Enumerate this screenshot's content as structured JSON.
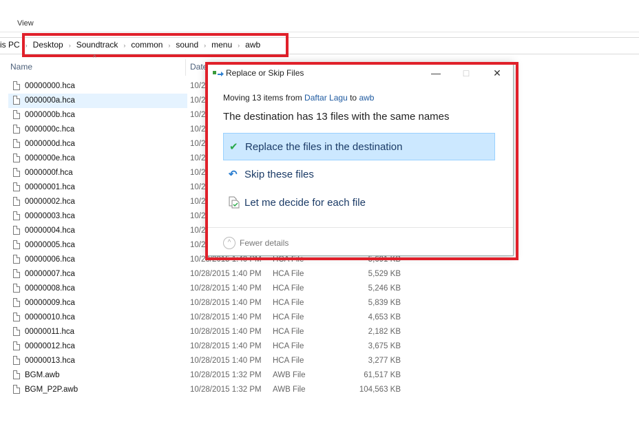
{
  "menu": {
    "view": "View"
  },
  "breadcrumb": {
    "prefix": "is PC",
    "items": [
      "Desktop",
      "Soundtrack",
      "common",
      "sound",
      "menu",
      "awb"
    ]
  },
  "columns": {
    "name": "Name",
    "date": "Date"
  },
  "files": [
    {
      "name": "00000000.hca",
      "date": "10/2",
      "type": "",
      "size": ""
    },
    {
      "name": "0000000a.hca",
      "date": "10/2",
      "type": "",
      "size": "",
      "selected": true
    },
    {
      "name": "0000000b.hca",
      "date": "10/2",
      "type": "",
      "size": ""
    },
    {
      "name": "0000000c.hca",
      "date": "10/2",
      "type": "",
      "size": ""
    },
    {
      "name": "0000000d.hca",
      "date": "10/2",
      "type": "",
      "size": ""
    },
    {
      "name": "0000000e.hca",
      "date": "10/2",
      "type": "",
      "size": ""
    },
    {
      "name": "0000000f.hca",
      "date": "10/2",
      "type": "",
      "size": ""
    },
    {
      "name": "00000001.hca",
      "date": "10/2",
      "type": "",
      "size": ""
    },
    {
      "name": "00000002.hca",
      "date": "10/2",
      "type": "",
      "size": ""
    },
    {
      "name": "00000003.hca",
      "date": "10/2",
      "type": "",
      "size": ""
    },
    {
      "name": "00000004.hca",
      "date": "10/2",
      "type": "",
      "size": ""
    },
    {
      "name": "00000005.hca",
      "date": "10/2",
      "type": "",
      "size": ""
    },
    {
      "name": "00000006.hca",
      "date": "10/28/2015 1:40 PM",
      "type": "HCA File",
      "size": "5,691 KB"
    },
    {
      "name": "00000007.hca",
      "date": "10/28/2015 1:40 PM",
      "type": "HCA File",
      "size": "5,529 KB"
    },
    {
      "name": "00000008.hca",
      "date": "10/28/2015 1:40 PM",
      "type": "HCA File",
      "size": "5,246 KB"
    },
    {
      "name": "00000009.hca",
      "date": "10/28/2015 1:40 PM",
      "type": "HCA File",
      "size": "5,839 KB"
    },
    {
      "name": "00000010.hca",
      "date": "10/28/2015 1:40 PM",
      "type": "HCA File",
      "size": "4,653 KB"
    },
    {
      "name": "00000011.hca",
      "date": "10/28/2015 1:40 PM",
      "type": "HCA File",
      "size": "2,182 KB"
    },
    {
      "name": "00000012.hca",
      "date": "10/28/2015 1:40 PM",
      "type": "HCA File",
      "size": "3,675 KB"
    },
    {
      "name": "00000013.hca",
      "date": "10/28/2015 1:40 PM",
      "type": "HCA File",
      "size": "3,277 KB"
    },
    {
      "name": "BGM.awb",
      "date": "10/28/2015 1:32 PM",
      "type": "AWB File",
      "size": "61,517 KB"
    },
    {
      "name": "BGM_P2P.awb",
      "date": "10/28/2015 1:32 PM",
      "type": "AWB File",
      "size": "104,563 KB"
    }
  ],
  "dialog": {
    "title": "Replace or Skip Files",
    "moving_prefix": "Moving 13 items from ",
    "source": "Daftar Lagu",
    "to": " to ",
    "target": "awb",
    "heading": "The destination has 13 files with the same names",
    "options": [
      {
        "label": "Replace the files in the destination",
        "icon": "checkmark-icon"
      },
      {
        "label": "Skip these files",
        "icon": "skip-arrow-icon"
      },
      {
        "label": "Let me decide for each file",
        "icon": "decide-file-icon"
      }
    ],
    "fewer_details": "Fewer details"
  },
  "colors": {
    "highlight": "#e0202a",
    "link": "#1e5aa0",
    "selected_option": "#cce8ff"
  }
}
